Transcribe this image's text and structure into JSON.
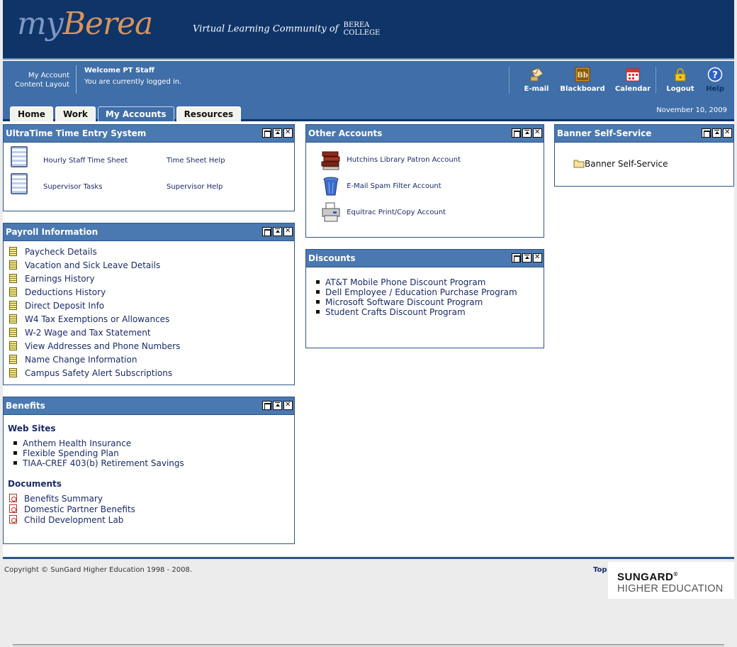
{
  "header": {
    "logo_my": "my",
    "logo_berea": "Berea",
    "tagline": "Virtual Learning Community of",
    "college_line1": "BEREA",
    "college_line2": "COLLEGE"
  },
  "toolbar": {
    "my_account": "My Account",
    "content_layout": "Content Layout",
    "welcome": "Welcome PT Staff",
    "logged_in": "You are currently logged in.",
    "links": {
      "email": "E-mail",
      "blackboard": "Blackboard",
      "calendar": "Calendar",
      "logout": "Logout",
      "help": "Help"
    },
    "date": "November 10, 2009"
  },
  "tabs": [
    {
      "label": "Home",
      "active": false
    },
    {
      "label": "Work",
      "active": false
    },
    {
      "label": "My Accounts",
      "active": true
    },
    {
      "label": "Resources",
      "active": false
    }
  ],
  "ultratime": {
    "title": "UltraTime Time Entry System",
    "hourly": "Hourly Staff Time Sheet",
    "timesheet_help": "Time Sheet Help",
    "supervisor_tasks": "Supervisor Tasks",
    "supervisor_help": "Supervisor Help"
  },
  "payroll": {
    "title": "Payroll Information",
    "items": [
      "Paycheck Details",
      "Vacation and Sick Leave Details",
      "Earnings History",
      "Deductions History",
      "Direct Deposit Info",
      "W4 Tax Exemptions or Allowances",
      "W-2 Wage and Tax Statement",
      "View Addresses and Phone Numbers",
      "Name Change Information",
      "Campus Safety Alert Subscriptions"
    ]
  },
  "benefits": {
    "title": "Benefits",
    "websites_heading": "Web Sites",
    "websites": [
      "Anthem Health Insurance",
      "Flexible Spending Plan",
      "TIAA-CREF 403(b) Retirement Savings"
    ],
    "documents_heading": "Documents",
    "documents": [
      "Benefits Summary",
      "Domestic Partner Benefits",
      "Child Development Lab"
    ]
  },
  "other_accounts": {
    "title": "Other Accounts",
    "items": [
      "Hutchins Library Patron Account",
      "E-Mail Spam Filter Account",
      "Equitrac Print/Copy Account"
    ]
  },
  "discounts": {
    "title": "Discounts",
    "items": [
      "AT&T Mobile Phone Discount Program",
      "Dell Employee / Education Purchase Program",
      "Microsoft Software Discount Program",
      "Student Crafts Discount Program"
    ]
  },
  "banner": {
    "title": "Banner Self-Service",
    "link": "Banner Self-Service"
  },
  "footer": {
    "copyright": "Copyright © SunGard Higher Education 1998 - 2008.",
    "top": "Top",
    "sungard1": "SUNGARD",
    "sungard_reg": "®",
    "sungard2": "HIGHER EDUCATION"
  }
}
